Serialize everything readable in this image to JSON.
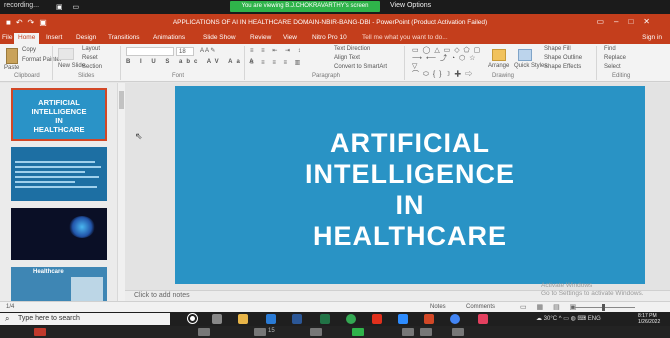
{
  "meeting": {
    "left_label": "recording...",
    "share_banner": "You are viewing B.J.CHOKRAVARTHY's screen",
    "view_options": "View Options"
  },
  "window": {
    "title": "APPLICATIONS OF AI IN HEALTHCARE DOMAIN-NBIR-BANG-DBI - PowerPoint (Product Activation Failed)",
    "sign_in": "Sign in"
  },
  "tabs": [
    {
      "label": "Home",
      "active": true
    },
    {
      "label": "Insert"
    },
    {
      "label": "Design"
    },
    {
      "label": "Transitions"
    },
    {
      "label": "Animations"
    },
    {
      "label": "Slide Show"
    },
    {
      "label": "Review"
    },
    {
      "label": "View"
    },
    {
      "label": "Nitro Pro 10"
    }
  ],
  "tell_me": "Tell me what you want to do...",
  "ribbon": {
    "clipboard": {
      "paste": "Paste",
      "copy": "Copy",
      "format_painter": "Format Painter",
      "group": "Clipboard"
    },
    "slides": {
      "new_slide": "New Slide",
      "layout": "Layout",
      "reset": "Reset",
      "section": "Section",
      "group": "Slides"
    },
    "font": {
      "size": "18",
      "group": "Font"
    },
    "paragraph": {
      "text_direction": "Text Direction",
      "align_text": "Align Text",
      "smartart": "Convert to SmartArt",
      "group": "Paragraph"
    },
    "drawing": {
      "arrange": "Arrange",
      "quick_styles": "Quick Styles",
      "shape_fill": "Shape Fill",
      "shape_outline": "Shape Outline",
      "shape_effects": "Shape Effects",
      "group": "Drawing"
    },
    "editing": {
      "find": "Find",
      "replace": "Replace",
      "select": "Select",
      "group": "Editing"
    }
  },
  "thumbnails": {
    "slide1_lines": [
      "ARTIFICIAL",
      "INTELLIGENCE",
      "IN",
      "HEALTHCARE"
    ],
    "slide4_title": "Healthcare"
  },
  "slide": {
    "title_lines": [
      "ARTIFICIAL",
      "INTELLIGENCE",
      "IN",
      "HEALTHCARE"
    ]
  },
  "notes_placeholder": "Click to add notes",
  "activate_windows": [
    "Activate Windows",
    "Go to Settings to activate Windows."
  ],
  "status": {
    "slide_count": "1/4",
    "notes": "Notes",
    "comments": "Comments"
  },
  "taskbar": {
    "search_placeholder": "Type here to search",
    "temperature": "30°C",
    "time": "8:17 PM",
    "date": "1/26/2022"
  },
  "zoom_controls": {
    "participants_count": "15"
  },
  "colors": {
    "ppt_orange": "#c43e1c",
    "slide_blue": "#2993c5",
    "share_green": "#2fb34a"
  }
}
